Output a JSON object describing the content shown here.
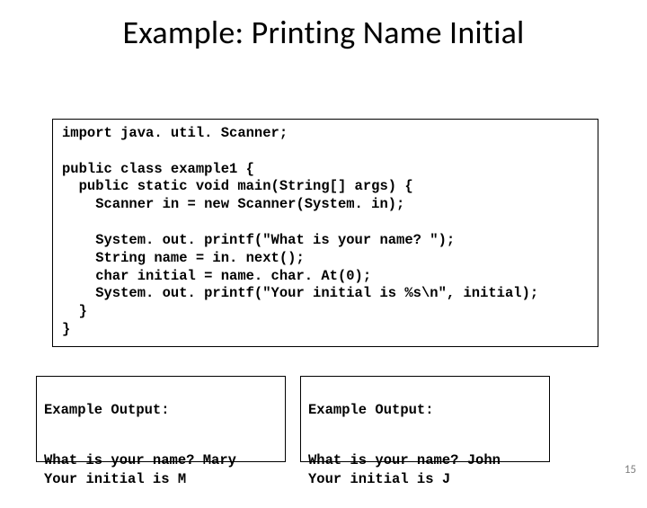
{
  "title": "Example: Printing Name Initial",
  "code": "import java. util. Scanner;\n\npublic class example1 {\n  public static void main(String[] args) {\n    Scanner in = new Scanner(System. in);\n\n    System. out. printf(\"What is your name? \");\n    String name = in. next();\n    char initial = name. char. At(0);\n    System. out. printf(\"Your initial is %s\\n\", initial);\n  }\n}",
  "output_left": {
    "heading": "Example Output:",
    "body": "What is your name? Mary\nYour initial is M"
  },
  "output_right": {
    "heading": "Example Output:",
    "body": "What is your name? John\nYour initial is J"
  },
  "page_number": "15"
}
